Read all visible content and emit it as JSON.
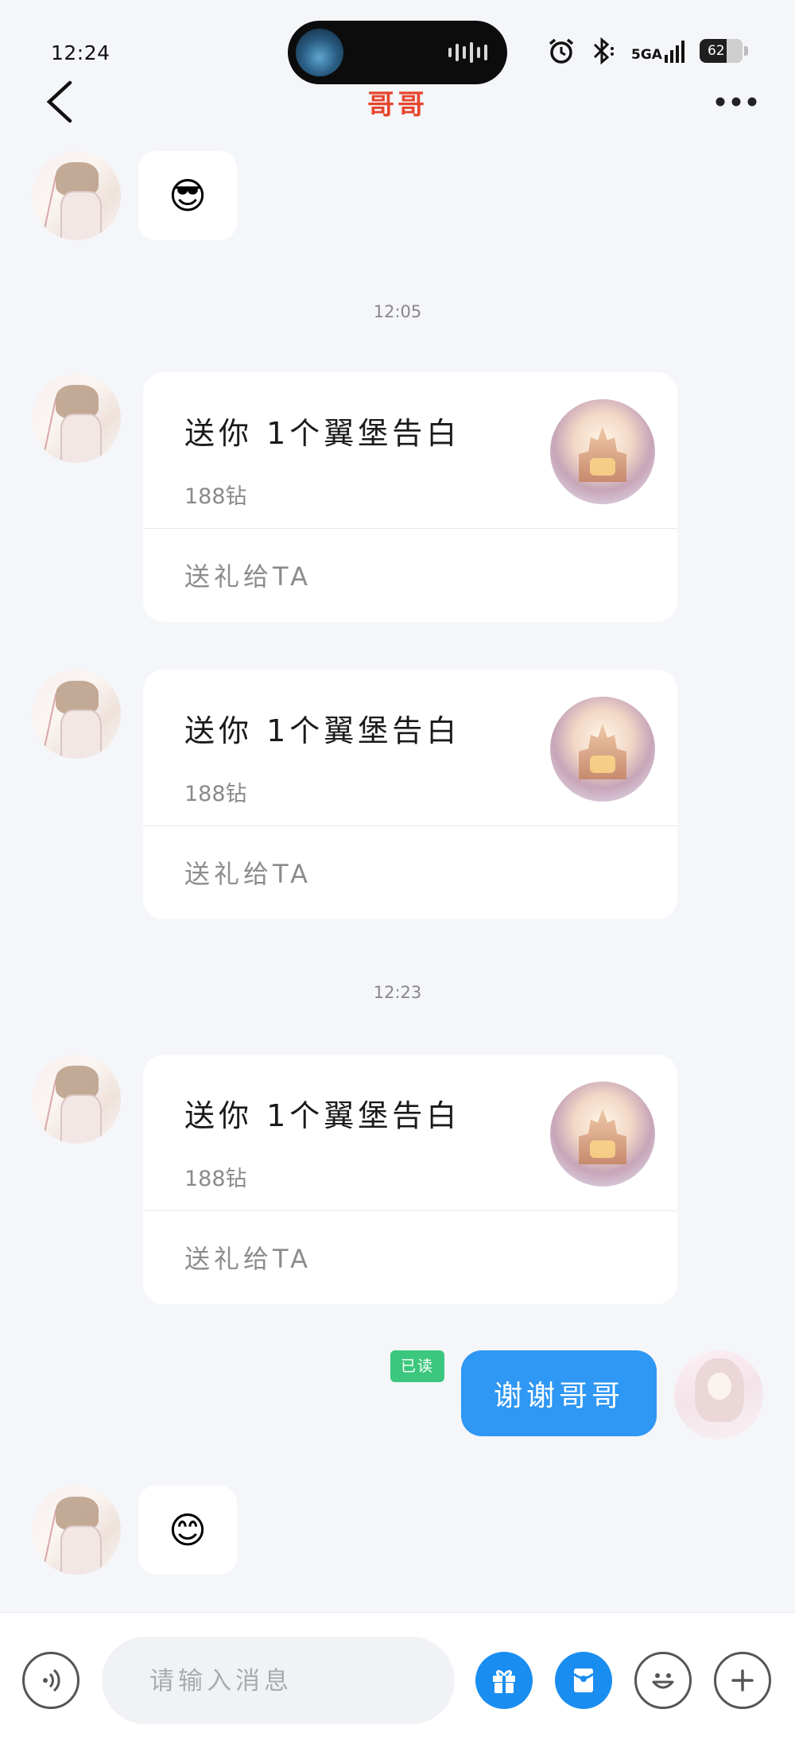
{
  "status_bar": {
    "time": "12:24",
    "signal_label": "5GA",
    "battery": "62"
  },
  "header": {
    "title": "哥哥"
  },
  "messages": {
    "first_emoji": "😎",
    "timestamp_1": "12:05",
    "gift_1": {
      "title": "送你 1个翼堡告白",
      "price": "188钻",
      "action": "送礼给TA"
    },
    "gift_2": {
      "title": "送你 1个翼堡告白",
      "price": "188钻",
      "action": "送礼给TA"
    },
    "timestamp_2": "12:23",
    "gift_3": {
      "title": "送你 1个翼堡告白",
      "price": "188钻",
      "action": "送礼给TA"
    },
    "read_badge": "已读",
    "self_text": "谢谢哥哥",
    "last_emoji": "😊"
  },
  "input": {
    "placeholder": "请输入消息"
  },
  "icons": [
    "back-icon",
    "more-icon",
    "alarm-icon",
    "bluetooth-icon",
    "signal-icon",
    "battery-icon",
    "voice-icon",
    "gift-icon",
    "red-packet-icon",
    "emoji-icon",
    "plus-icon"
  ],
  "colors": {
    "title": "#e6462e",
    "self_bubble": "#2f97f4",
    "read_badge": "#3bc77d",
    "action_blue": "#1a8df0"
  }
}
